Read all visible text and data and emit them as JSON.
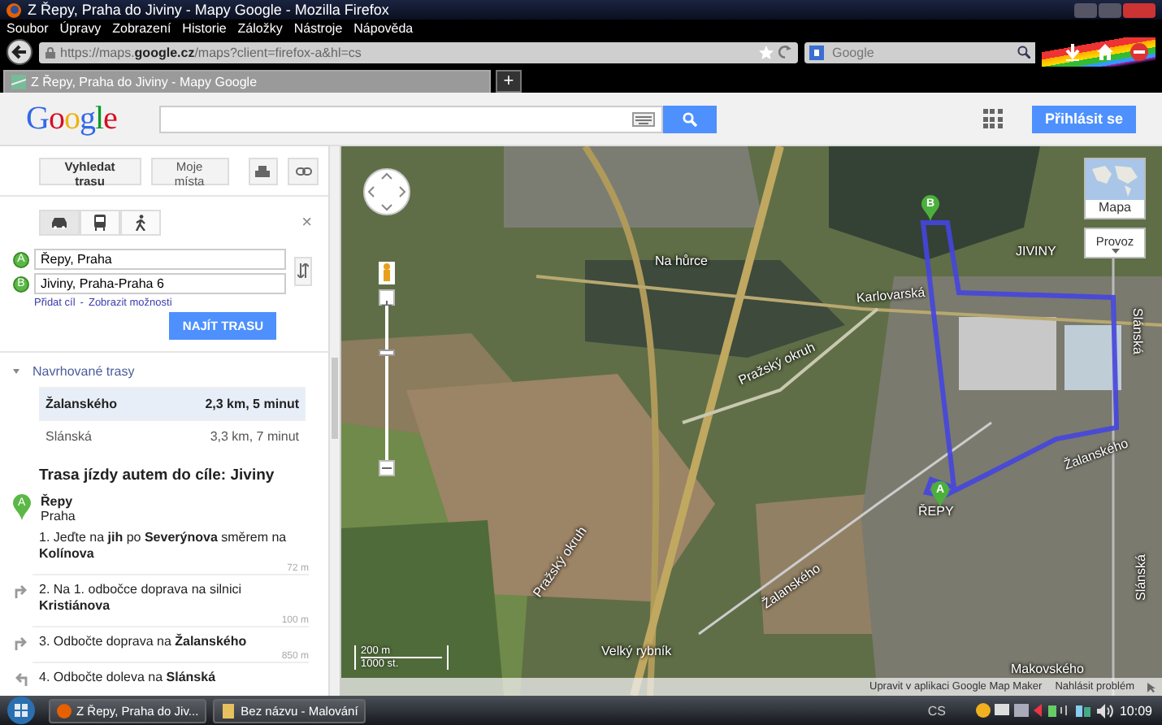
{
  "window": {
    "title": "Z Řepy, Praha do Jiviny - Mapy Google - Mozilla Firefox"
  },
  "menu": [
    "Soubor",
    "Úpravy",
    "Zobrazení",
    "Historie",
    "Záložky",
    "Nástroje",
    "Nápověda"
  ],
  "address_bar": {
    "url": "https://maps.**google.cz**/maps?client=firefox-a&hl=cs"
  },
  "search_bar": {
    "placeholder": "Google"
  },
  "tabs": [
    {
      "label": "Z Řepy, Praha do Jiviny - Mapy Google",
      "selected": true
    }
  ],
  "new_tab": "+",
  "header": {
    "logo": "Google",
    "sign_in": "Přihlásit se"
  },
  "sidebar": {
    "buttons": [
      "Vyhledat trasu",
      "Moje místa"
    ],
    "close": "×",
    "modes": [
      {
        "kind": "car",
        "selected": true
      },
      {
        "kind": "transit",
        "selected": false
      },
      {
        "kind": "walk",
        "selected": false
      }
    ],
    "waypoints": [
      {
        "marker": "A",
        "value": "Řepy, Praha"
      },
      {
        "marker": "B",
        "value": "Jiviny, Praha-Praha 6"
      }
    ],
    "links": [
      "Přidat cíl",
      "Zobrazit možnosti"
    ],
    "link_separator": "-",
    "find_button": "NAJÍT TRASU",
    "suggested": {
      "heading": "Navrhované trasy",
      "expanded": true,
      "routes": [
        {
          "name": "Žalanského",
          "summary": "2,3 km, 5 minut",
          "selected": true
        },
        {
          "name": "Slánská",
          "summary": "3,3 km, 7 minut",
          "selected": false
        }
      ]
    },
    "directions": {
      "title": "Trasa jízdy autem do cíle: Jiviny",
      "start": {
        "marker": "A",
        "name": "Řepy",
        "place": "Praha"
      },
      "steps": [
        {
          "text": "1. Jeďte na **jih** po **Severýnova** směrem na **Kolínova**",
          "kind": "straight",
          "distance": "72 m"
        },
        {
          "text": "2. Na 1. odbočce doprava na silnici **Kristiánova**",
          "kind": "right",
          "distance": "100 m"
        },
        {
          "text": "3. Odbočte doprava na **Žalanského**",
          "kind": "right",
          "distance": "850 m"
        },
        {
          "text": "4. Odbočte doleva na **Slánská**",
          "kind": "left"
        }
      ]
    }
  },
  "map": {
    "labels": [
      "Na hůrce",
      "Karlovarská",
      "Pražský okruh",
      "Pražský okruh",
      "JIVINY",
      "ŘEPY",
      "Žalanského",
      "Žalanského",
      "Slánská",
      "Slánská",
      "Makovského",
      "Velký rybník"
    ],
    "markers": [
      "A",
      "B"
    ],
    "zoom": {
      "level": 0.7
    },
    "map_type": "Mapa",
    "traffic": "Provoz",
    "scale": [
      "200 m",
      "1000 st."
    ],
    "footer": [
      "Upravit v aplikaci Google Map Maker",
      "Nahlásit problém"
    ]
  },
  "taskbar": {
    "tasks": [
      "Z Řepy, Praha do Jiv...",
      "Bez názvu - Malování"
    ],
    "language": "CS",
    "clock": "10:09"
  }
}
